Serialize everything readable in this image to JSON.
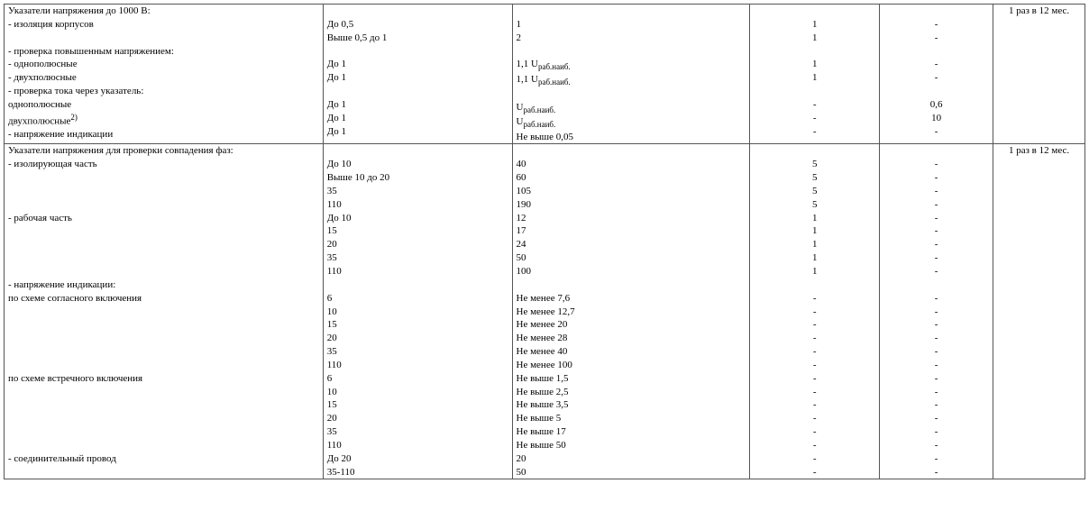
{
  "row1": {
    "col1": [
      "Указатели напряжения до 1000 В:",
      "- изоляция корпусов",
      "",
      "- проверка повышенным напряжением:",
      "- однополюсные",
      "- двухполюсные",
      "- проверка тока через указатель:",
      "однополюсные",
      "двухполюсные",
      "- напряжение индикации"
    ],
    "col1_sup": "2)",
    "col2": [
      "",
      "До 0,5",
      "Выше 0,5 до 1",
      "",
      "До 1",
      "До 1",
      "",
      "До 1",
      "До 1",
      "До 1"
    ],
    "col3": [
      "",
      "1",
      "2",
      "",
      "1,1 U",
      "1,1 U",
      "",
      "U",
      "U",
      "Не выше 0,05"
    ],
    "col3_sub": "раб.наиб.",
    "col4": [
      "",
      "1",
      "1",
      "",
      "1",
      "1",
      "",
      "-",
      "-",
      "-"
    ],
    "col5": [
      "",
      "-",
      "-",
      "",
      "-",
      "-",
      "",
      "0,6",
      "10",
      "-"
    ],
    "col6": "1 раз в 12 мес."
  },
  "row2": {
    "col1": [
      "Указатели напряжения для проверки совпадения фаз:",
      "- изолирующая часть",
      "",
      "",
      "",
      "- рабочая часть",
      "",
      "",
      "",
      "",
      "- напряжение индикации:",
      "по схеме согласного включения",
      "",
      "",
      "",
      "",
      "",
      "по схеме встречного включения",
      "",
      "",
      "",
      "",
      "",
      "- соединительный провод",
      ""
    ],
    "col2": [
      "",
      "До 10",
      "Выше 10 до 20",
      "35",
      "110",
      "До 10",
      "15",
      "20",
      "35",
      "110",
      "",
      "6",
      "10",
      "15",
      "20",
      "35",
      "110",
      "6",
      "10",
      "15",
      "20",
      "35",
      "110",
      "До 20",
      "35-110"
    ],
    "col3": [
      "",
      "40",
      "60",
      "105",
      "190",
      "12",
      "17",
      "24",
      "50",
      "100",
      "",
      "Не менее 7,6",
      "Не менее 12,7",
      "Не менее 20",
      "Не менее 28",
      "Не менее 40",
      "Не менее 100",
      "Не выше 1,5",
      "Не выше 2,5",
      "Не выше 3,5",
      "Не выше 5",
      "Не выше 17",
      "Не выше 50",
      "20",
      "50"
    ],
    "col4": [
      "",
      "5",
      "5",
      "5",
      "5",
      "1",
      "1",
      "1",
      "1",
      "1",
      "",
      "-",
      "-",
      "-",
      "-",
      "-",
      "-",
      "-",
      "-",
      "-",
      "-",
      "-",
      "-",
      "-",
      "-"
    ],
    "col5": [
      "",
      "-",
      "-",
      "-",
      "-",
      "-",
      "-",
      "-",
      "-",
      "-",
      "",
      "-",
      "-",
      "-",
      "-",
      "-",
      "-",
      "-",
      "-",
      "-",
      "-",
      "-",
      "-",
      "-",
      "-"
    ],
    "col6": "1 раз в 12 мес."
  }
}
